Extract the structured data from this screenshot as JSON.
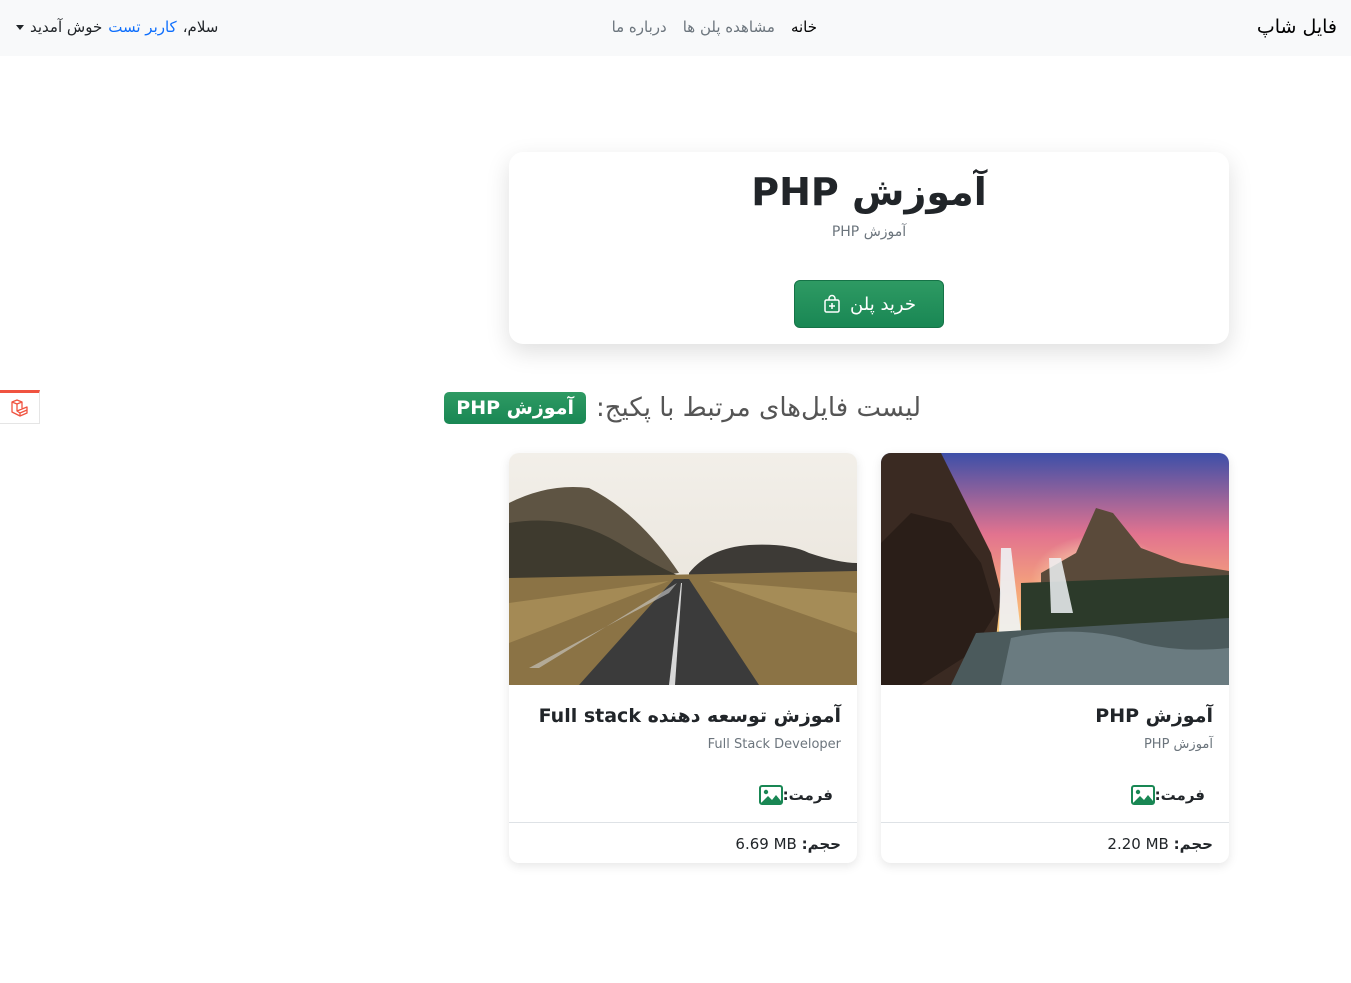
{
  "navbar": {
    "brand": "فایل شاپ",
    "links": [
      {
        "label": "خانه"
      },
      {
        "label": "مشاهده پلن ها"
      },
      {
        "label": "درباره ما"
      }
    ],
    "user": {
      "greeting": "سلام،",
      "name": "کاربر تست",
      "welcome": "خوش آمدید"
    }
  },
  "hero": {
    "title": "آموزش PHP",
    "subtitle": "آموزش PHP",
    "buy_label": "خرید پلن"
  },
  "section": {
    "heading": "لیست فایل‌های مرتبط با پکیج:",
    "package_badge": "آموزش PHP"
  },
  "files": [
    {
      "title": "آموزش PHP",
      "subtitle": "آموزش PHP",
      "format_label": "فرمت:",
      "format_icon": "image-icon",
      "size_label": "حجم:",
      "size_value": "2.20 MB"
    },
    {
      "title": "آموزش توسعه دهنده Full stack",
      "subtitle": "Full Stack Developer",
      "format_label": "فرمت:",
      "format_icon": "image-icon",
      "size_label": "حجم:",
      "size_value": "6.69 MB"
    }
  ],
  "colors": {
    "accent": "#198754",
    "link": "#0d6efd",
    "navbar_bg": "#f8f9fa",
    "laravel_red": "#f05340"
  }
}
